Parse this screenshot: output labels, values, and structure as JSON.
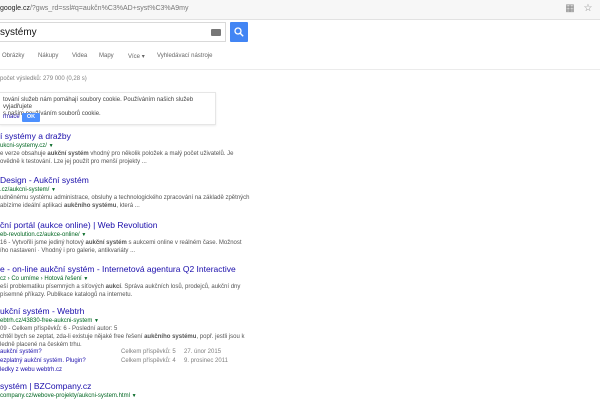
{
  "address_bar": {
    "url_domain": "google.cz",
    "url_rest": "/?gws_rd=ssl#q=aukčn%C3%AD+syst%C3%A9my",
    "icons": [
      "bookmark-page-icon",
      "star-icon"
    ]
  },
  "search": {
    "query": "systémy",
    "keyboard_icon": "keyboard-icon",
    "button_icon": "search-icon",
    "accent": "#4285f4"
  },
  "tabs": [
    "Obrázky",
    "Nákupy",
    "Videa",
    "Mapy",
    "Více",
    "Vyhledávací nástroje"
  ],
  "stats": "počet výsledků: 279 000 (0,28 s)",
  "cookie": {
    "line1": "tování služeb nám pomáhají soubory cookie. Používáním našich služeb vyjadřujete",
    "line2": "s naším používáním souborů cookie.",
    "more": "rmace",
    "ok": "OK"
  },
  "results": [
    {
      "title": "í systémy a dražby",
      "url": "ukcni-systemy.cz/",
      "snippet": [
        {
          "pre": "e verze obsahuje ",
          "bold": "aukční systém",
          "post": " vhodný pro několik položek a malý počet uživatelů. Je"
        },
        {
          "pre": "ovědně k testování. Lze jej použít pro menší projekty ...",
          "bold": "",
          "post": ""
        }
      ]
    },
    {
      "title": "Design - Aukční systém",
      "url": ".cz/aukcni-system/",
      "snippet": [
        {
          "pre": "udněnému systému administrace, obsluhy a technologického zpracování na základě zpětných",
          "bold": "",
          "post": ""
        },
        {
          "pre": "abízíme ideální aplikaci ",
          "bold": "aukčního systému",
          "post": ", která ..."
        }
      ]
    },
    {
      "title": "ční portál (aukce online) | Web Revolution",
      "url": "eb-revolution.cz/aukce-online/",
      "snippet": [
        {
          "pre": "16 - Vytvořili jsme jediný hotový ",
          "bold": "aukční systém",
          "post": " s aukcemi online v reálném čase. Možnost"
        },
        {
          "pre": "ího nastavení · Vhodný i pro galerie, antikvariáty ...",
          "bold": "",
          "post": ""
        }
      ]
    },
    {
      "title": "e - on-line aukční systém - Internetová agentura Q2 Interactive",
      "url": "cz › Co umíme › Hotová řešení",
      "snippet": [
        {
          "pre": "eší problematiku písemných a síťových ",
          "bold": "aukcí",
          "post": ". Správa aukčních losů, prodejců, aukční dny"
        },
        {
          "pre": "písemné příkazy. Publikace katalogů na internetu.",
          "bold": "",
          "post": ""
        }
      ]
    },
    {
      "title": "ukční systém - Webtrh",
      "url": "ebtrh.cz/43830-free-aukcni-system",
      "snippet": [
        {
          "pre": "09 - Celkem příspěvků: 6 - Poslední autor: 5",
          "bold": "",
          "post": ""
        },
        {
          "pre": "chtěl bych se zeptat, zda-li existuje nějaké free řešení ",
          "bold": "aukčního systému",
          "post": ", popř. jestli jsou k"
        },
        {
          "pre": "ledně placené na českém trhu.",
          "bold": "",
          "post": ""
        }
      ]
    },
    {
      "title": "systém | BZCompany.cz",
      "url": "company.cz/webove-projekty/aukcni-system.html",
      "snippet": []
    }
  ],
  "sublinks": [
    {
      "link": "aukční systém?",
      "meta1": "Celkem příspěvků: 5",
      "meta2": "27. únor 2015"
    },
    {
      "link": "ezplatný aukční systém. Plugin?",
      "meta1": "Celkem příspěvků: 4",
      "meta2": "9. prosinec 2011"
    },
    {
      "link": "ledky z webu webtrh.cz",
      "meta1": "",
      "meta2": ""
    }
  ]
}
